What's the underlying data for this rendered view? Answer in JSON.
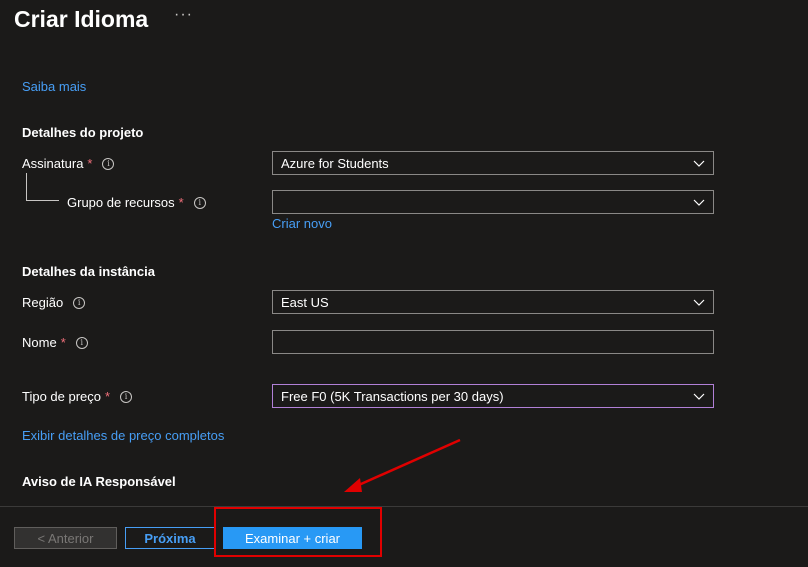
{
  "header": {
    "title": "Criar Idioma",
    "more": "···"
  },
  "learn_more": "Saiba mais",
  "project_details": {
    "heading": "Detalhes do projeto",
    "subscription": {
      "label": "Assinatura",
      "required": "*",
      "value": "Azure for Students"
    },
    "resource_group": {
      "label": "Grupo de recursos",
      "required": "*",
      "value": "",
      "create_new": "Criar novo"
    }
  },
  "instance_details": {
    "heading": "Detalhes da instância",
    "region": {
      "label": "Região",
      "value": "East US"
    },
    "name": {
      "label": "Nome",
      "required": "*",
      "value": ""
    }
  },
  "pricing": {
    "label": "Tipo de preço",
    "required": "*",
    "value": "Free F0 (5K Transactions per 30 days)",
    "details_link": "Exibir detalhes de preço completos"
  },
  "responsible_ai": {
    "heading": "Aviso de IA Responsável"
  },
  "footer": {
    "previous": "< Anterior",
    "next": "Próxima",
    "review_create": "Examinar + criar"
  },
  "info_glyph": "i",
  "colors": {
    "accent": "#479ef5",
    "primary_button": "#2899f5",
    "annotation": "#e00000",
    "pricing_border": "#b180d7"
  }
}
